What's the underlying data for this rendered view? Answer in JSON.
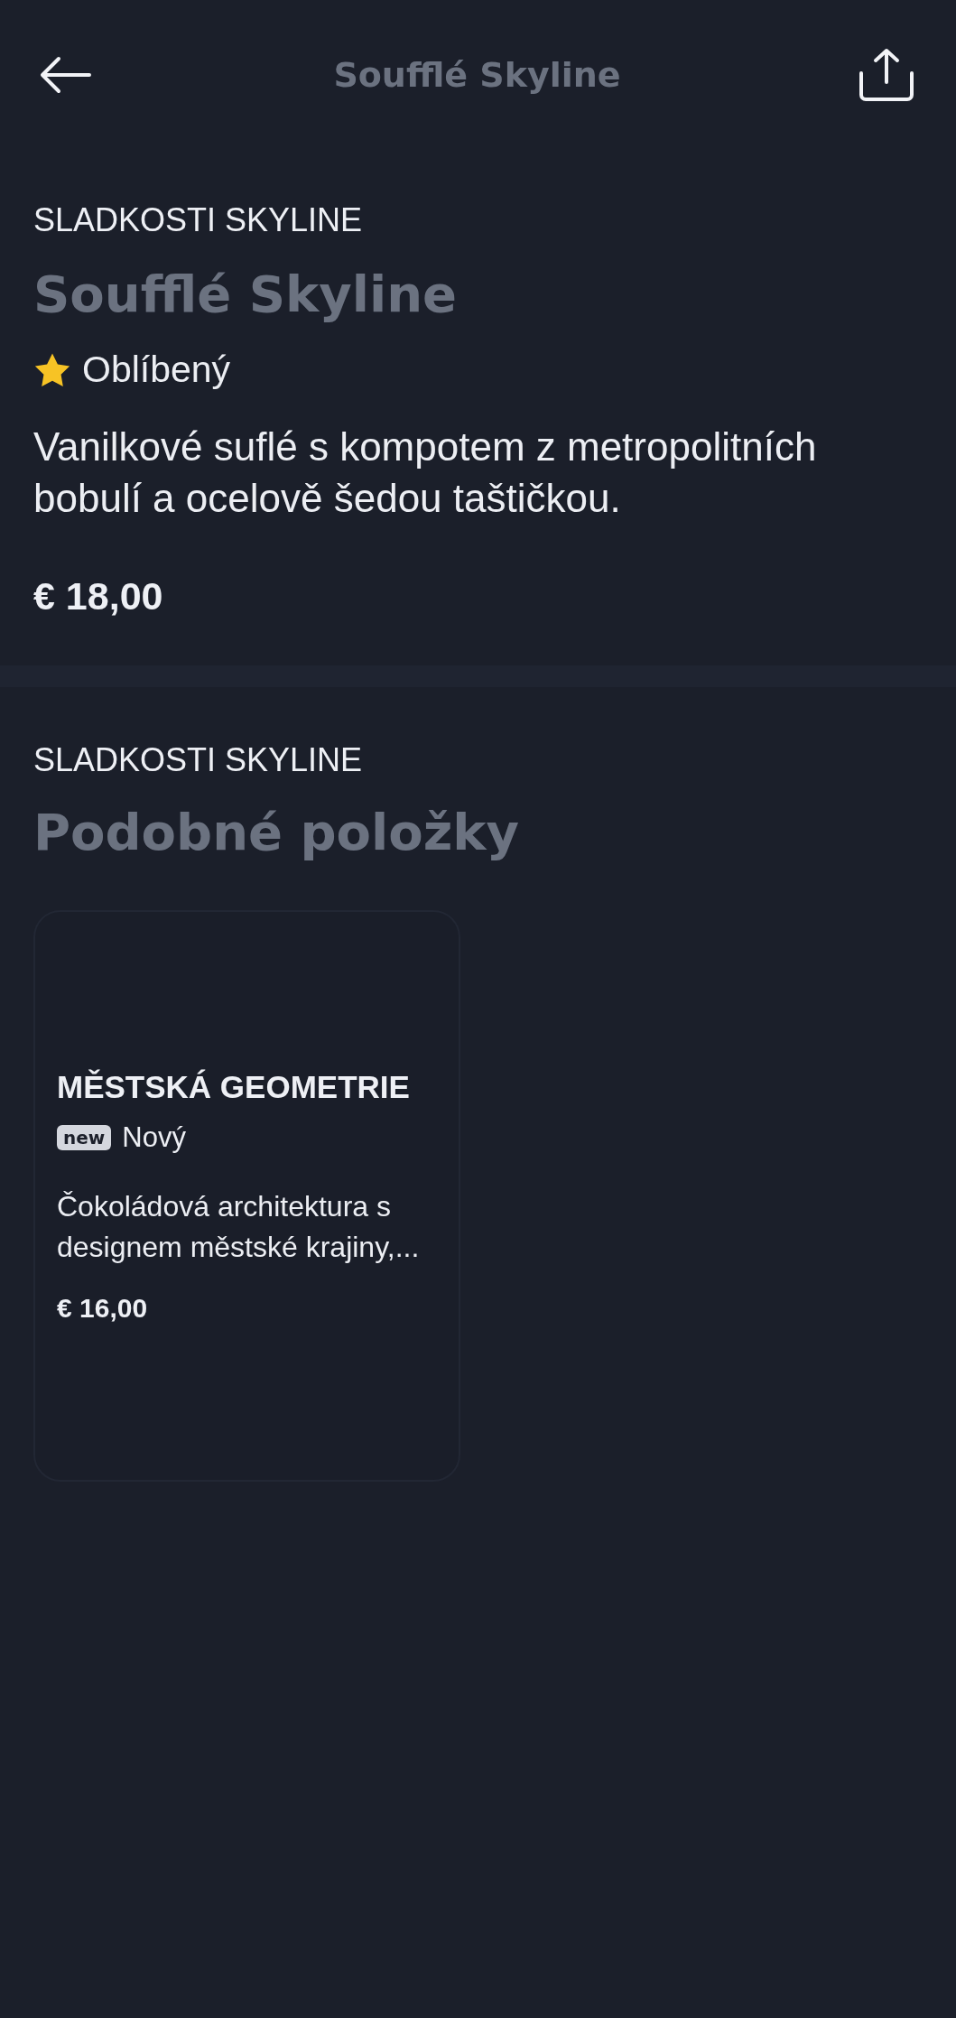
{
  "header": {
    "title": "Soufflé Skyline"
  },
  "product": {
    "category": "SLADKOSTI SKYLINE",
    "name": "Soufflé Skyline",
    "tag": {
      "kind": "star",
      "label": "Oblíbený"
    },
    "description": "Vanilkové suflé s kompotem z metropolitních bobulí a ocelově šedou taštičkou.",
    "price": "€ 18,00"
  },
  "similar": {
    "category": "SLADKOSTI SKYLINE",
    "title": "Podobné položky",
    "items": [
      {
        "name": "MĚSTSKÁ GEOMETRIE",
        "tag": {
          "kind": "badge",
          "badge": "new",
          "label": "Nový"
        },
        "description": "Čokoládová architektura s designem městské krajiny,...",
        "price": "€ 16,00"
      }
    ]
  }
}
